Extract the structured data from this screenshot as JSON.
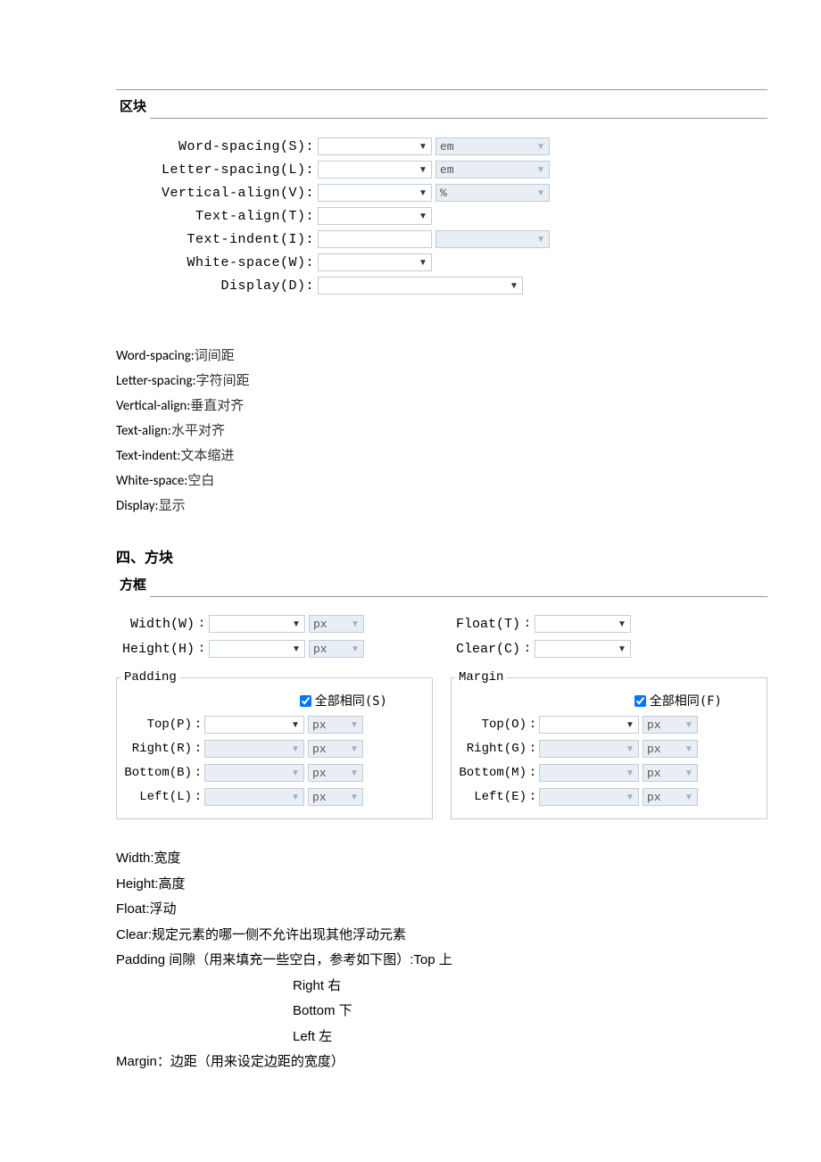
{
  "block_tab": "区块",
  "block_fields": {
    "word_spacing_label": "Word-spacing(S):",
    "letter_spacing_label": "Letter-spacing(L):",
    "vertical_align_label": "Vertical-align(V):",
    "text_align_label": "Text-align(T):",
    "text_indent_label": "Text-indent(I):",
    "white_space_label": "White-space(W):",
    "display_label": "Display(D):",
    "unit_em": "em",
    "unit_percent": "%"
  },
  "block_notes": [
    {
      "en": "Word-spacing:",
      "cn": "词间距"
    },
    {
      "en": "Letter-spacing:",
      "cn": "字符间距"
    },
    {
      "en": "Vertical-align:",
      "cn": "垂直对齐"
    },
    {
      "en": "Text-align:",
      "cn": "水平对齐"
    },
    {
      "en": "Text-indent:",
      "cn": "文本缩进"
    },
    {
      "en": "White-space:",
      "cn": "空白"
    },
    {
      "en": "Display:",
      "cn": "显示"
    }
  ],
  "section4_heading": "四、方块",
  "box_tab": "方框",
  "box_fields": {
    "width_label": "Width(W)",
    "height_label": "Height(H)",
    "float_label": "Float(T)",
    "clear_label": "Clear(C)",
    "unit_px": "px",
    "colon": " :"
  },
  "padding_group": {
    "legend": "Padding",
    "same_all": "全部相同(S)",
    "top": "Top(P)",
    "right": "Right(R)",
    "bottom": "Bottom(B)",
    "left": "Left(L)",
    "unit_px": "px"
  },
  "margin_group": {
    "legend": "Margin",
    "same_all": "全部相同(F)",
    "top": "Top(O)",
    "right": "Right(G)",
    "bottom": "Bottom(M)",
    "left": "Left(E)",
    "unit_px": "px"
  },
  "box_notes": {
    "width": {
      "en": "Width:",
      "cn": "宽度"
    },
    "height": {
      "en": "Height:",
      "cn": "高度"
    },
    "float": {
      "en": "Float:",
      "cn": "浮动"
    },
    "clear": {
      "en": "Clear:",
      "cn": "规定元素的哪一侧不允许出现其他浮动元素"
    },
    "padding_line": "Padding 间隙（用来填充一些空白，参考如下图）:Top  上",
    "right": "Right  右",
    "bottom": "Bottom  下",
    "left": "Left  左",
    "margin": "Margin：边距（用来设定边距的宽度）"
  }
}
